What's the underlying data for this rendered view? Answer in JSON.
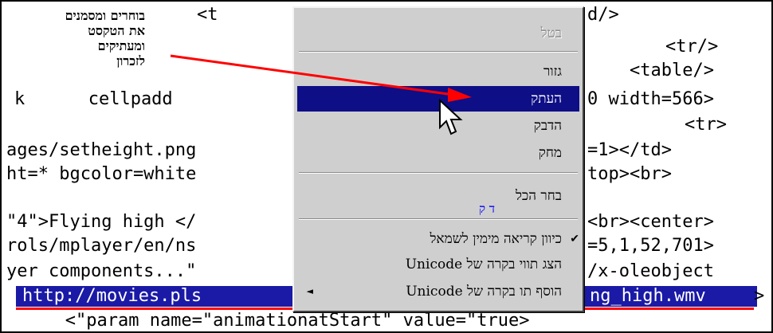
{
  "annotation": {
    "lines": [
      "בוחרים ומסמנים",
      "את הטקסט",
      "ומעתיקים",
      "לזכרון"
    ]
  },
  "code": {
    "lines": [
      {
        "left": "<t",
        "right": "d/>"
      },
      {
        "left": "",
        "right": "<tr/>"
      },
      {
        "left": "",
        "right": "<table/>"
      },
      {
        "left": "k      cellpadd",
        "right": "0 width=566>"
      },
      {
        "left": "",
        "right": "<tr>"
      },
      {
        "left": "ages/setheight.png",
        "right": "=1></td>"
      },
      {
        "left": "ht=* bgcolor=white",
        "right": "top><br>"
      },
      {
        "left": "\"4\">Flying high </",
        "right": "<br><center>"
      },
      {
        "left": "rols/mplayer/en/ns",
        "right": "=5,1,52,701>"
      },
      {
        "left": "yer components...\"",
        "right": "/x-oleobject"
      }
    ],
    "selected_left": "http://movies.pls",
    "selected_right": "ng_high.wmv",
    "selected_tail": ">",
    "last_line": "   <\"param name=\"animationatStart\" value=\"true>"
  },
  "context_menu": {
    "items": [
      {
        "label": "בטל",
        "state": "disabled"
      },
      {
        "label": "גזור",
        "state": "normal"
      },
      {
        "label": "העתק",
        "state": "highlighted"
      },
      {
        "label": "הדבק",
        "state": "normal"
      },
      {
        "label": "מחק",
        "state": "normal"
      },
      {
        "label": "בחר הכל",
        "state": "normal"
      },
      {
        "label": "כיוון קריאה מימין לשמאל",
        "state": "checked"
      },
      {
        "label": "הצג תווי בקרה של Unicode",
        "state": "normal"
      },
      {
        "label": "הוסף תו בקרה של Unicode",
        "state": "submenu"
      }
    ],
    "stray_glyph": "ד ק",
    "check_glyph": "✔",
    "submenu_glyph": "◄"
  },
  "colors": {
    "selection": "#1a1aa6",
    "menu_highlight": "#0e0e86",
    "annotation_arrow": "#ff0000"
  }
}
